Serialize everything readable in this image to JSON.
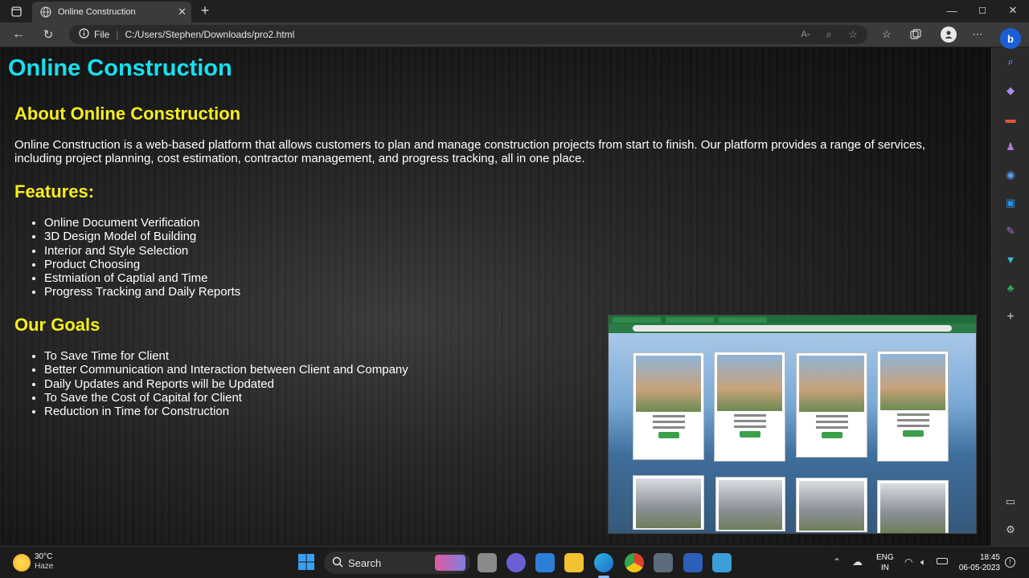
{
  "browser": {
    "tab_title": "Online Construction",
    "close_tab": "✕",
    "new_tab": "+",
    "address_prefix": "File",
    "url": "C:/Users/Stephen/Downloads/pro2.html",
    "window_controls": {
      "minimize": "—",
      "maximize": "☐",
      "close": "✕"
    }
  },
  "page": {
    "title": "Online Construction",
    "about_heading": "About Online Construction",
    "about_text": "Online Construction is a web-based platform that allows customers to plan and manage construction projects from start to finish. Our platform provides a range of services, including project planning, cost estimation, contractor management, and progress tracking, all in one place.",
    "features_heading": "Features:",
    "features": [
      "Online Document Verification",
      "3D Design Model of Building",
      "Interior and Style Selection",
      "Product Choosing",
      "Estmiation of Captial and Time",
      "Progress Tracking and Daily Reports"
    ],
    "goals_heading": "Our Goals",
    "goals": [
      "To Save Time for Client",
      "Better Communication and Interaction between Client and Company",
      "Daily Updates and Reports will be Updated",
      "To Save the Cost of Capital for Client",
      "Reduction in Time for Construction"
    ]
  },
  "taskbar": {
    "weather_temp": "30°C",
    "weather_desc": "Haze",
    "search_label": "Search",
    "lang_top": "ENG",
    "lang_bottom": "IN",
    "time": "18:45",
    "date": "06-05-2023"
  },
  "colors": {
    "title": "#16e0ee",
    "heading": "#f5ee1e",
    "body_text": "#ffffff"
  }
}
